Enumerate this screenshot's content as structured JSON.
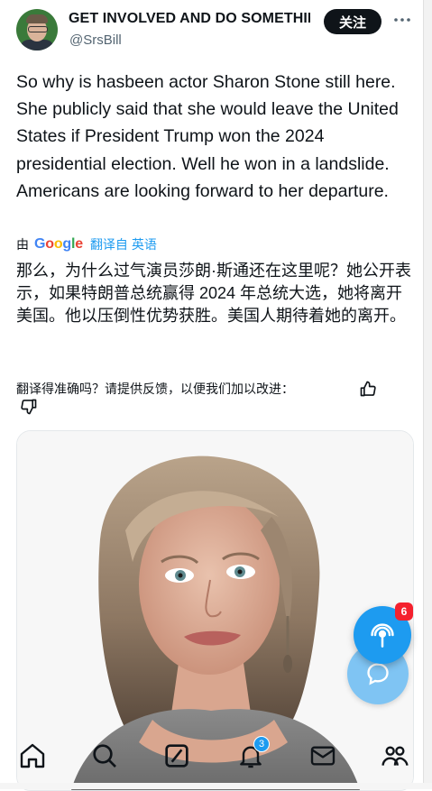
{
  "tweet": {
    "author_name": "GET INVOLVED AND DO SOMETHING",
    "author_handle": "@SrsBill",
    "follow_label": "关注",
    "more_icon": "more-horizontal-icon",
    "text": "So why is hasbeen actor Sharon Stone still here. She publicly said that she would leave the United States if President Trump won the 2024 presidential election. Well he won in a landslide.  Americans are looking forward to her departure.",
    "translated_by_prefix": "由",
    "translated_by_brand": "Google",
    "translated_by_link": "翻译自 英语",
    "translation": "那么，为什么过气演员莎朗·斯通还在这里呢？她公开表示，如果特朗普总统赢得 2024 年总统大选，她将离开美国。他以压倒性优势获胜。美国人期待着她的离开。",
    "feedback_prompt": "翻译得准确吗？请提供反馈，以便我们加以改进："
  },
  "floating": {
    "spaces_badge": "6",
    "spaces_icon": "spaces-mic-icon",
    "compose_icon": "message-plus-icon"
  },
  "nav": {
    "items": [
      "home-icon",
      "search-icon",
      "grok-icon",
      "notifications-icon",
      "messages-icon",
      "communities-icon"
    ],
    "notifications_badge": "3"
  },
  "colors": {
    "accent": "#1d9bf0",
    "text": "#0f1419",
    "secondary": "#536471",
    "badge_red": "#f4212e"
  }
}
